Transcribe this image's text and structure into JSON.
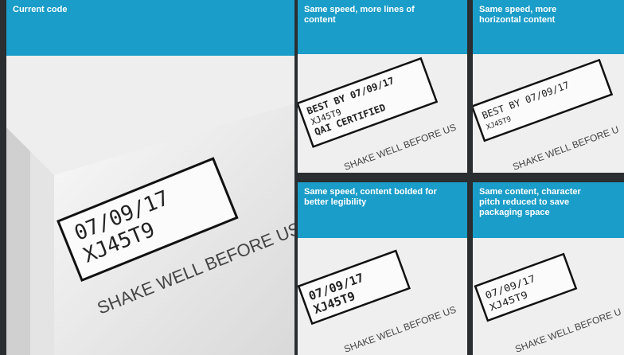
{
  "panels": [
    {
      "title": "Current code",
      "code_lines": [
        "07/09/17",
        "XJ45T9"
      ],
      "caption": "SHAKE WELL BEFORE US"
    },
    {
      "title": "Same speed, more lines of content",
      "code_lines": [
        "BEST BY 07/09/17",
        "XJ45T9",
        "QAI CERTIFIED"
      ],
      "caption": "SHAKE WELL BEFORE US"
    },
    {
      "title": "Same speed, more horizontal content",
      "code_lines": [
        "BEST BY 07/09/17",
        "XJ45T9"
      ],
      "caption": "SHAKE WELL BEFORE U"
    },
    {
      "title": "Same speed, content bolded for better legibility",
      "code_lines": [
        "07/09/17",
        "XJ45T9"
      ],
      "caption": "SHAKE WELL BEFORE US"
    },
    {
      "title": "Same content, character pitch reduced to save packaging space",
      "code_lines": [
        "07/09/17",
        "XJ45T9"
      ],
      "caption": "SHAKE WELL BEFORE U"
    }
  ],
  "colors": {
    "header_bg": "#1a9dc8",
    "frame_bg": "#2b2e30"
  }
}
